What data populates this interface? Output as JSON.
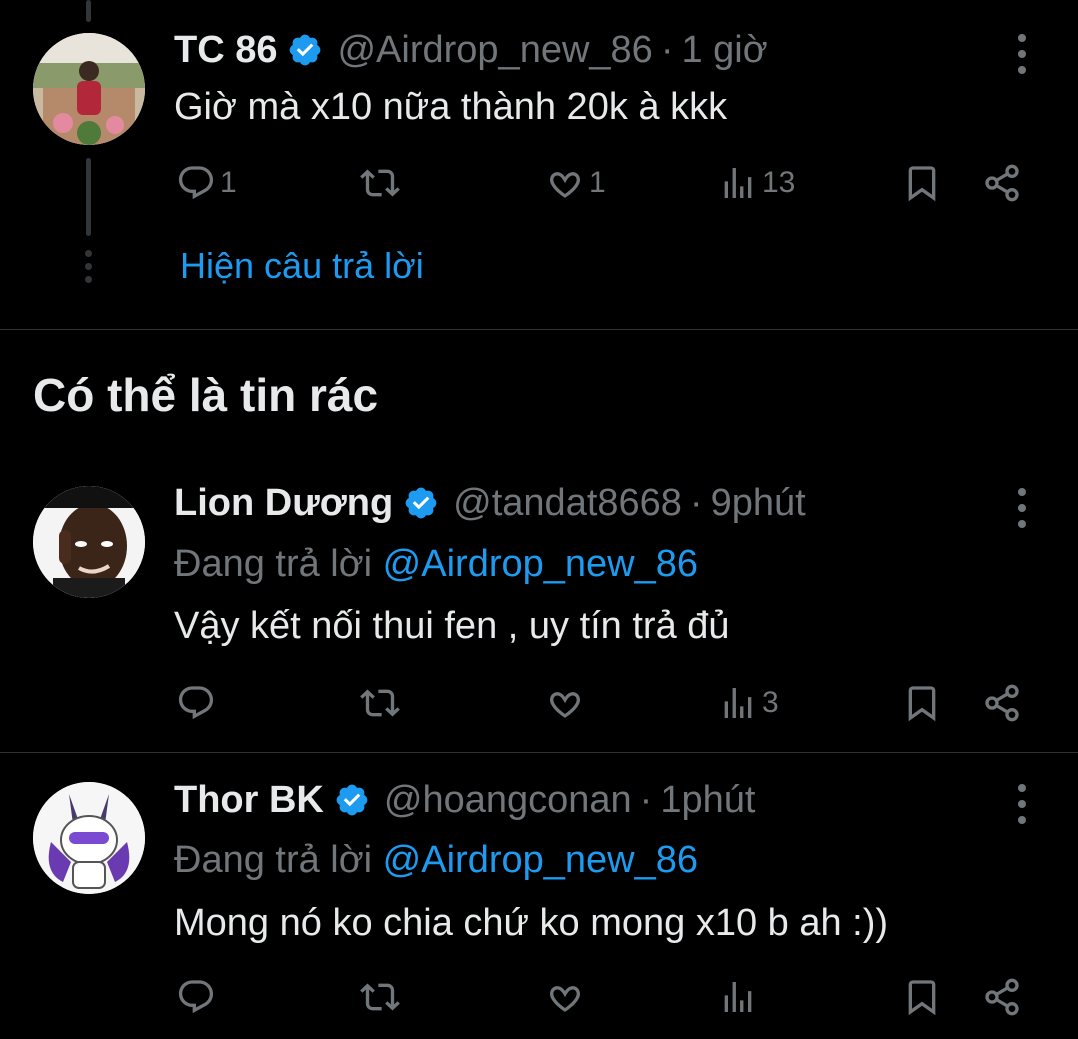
{
  "tweet1": {
    "name": "TC 86",
    "handle": "@Airdrop_new_86",
    "separator": "·",
    "time": "1 giờ",
    "text": "Giờ mà x10 nữa thành 20k à kkk",
    "replies": "1",
    "retweets": "",
    "likes": "1",
    "views": "13",
    "show_replies": "Hiện câu trả lời"
  },
  "section": {
    "title": "Có thể là tin rác"
  },
  "tweet2": {
    "name": "Lion Dương",
    "handle": "@tandat8668",
    "separator": "·",
    "time": "9phút",
    "replying_prefix": "Đang trả lời",
    "replying_to": "@Airdrop_new_86",
    "text": "Vậy kết nối thui fen , uy tín trả đủ",
    "views": "3"
  },
  "tweet3": {
    "name": "Thor BK",
    "handle": "@hoangconan",
    "separator": "·",
    "time": "1phút",
    "replying_prefix": "Đang trả lời",
    "replying_to": "@Airdrop_new_86",
    "text": "Mong nó ko chia chứ ko mong x10 b ah :))"
  },
  "colors": {
    "accent": "#1d9bf0",
    "muted": "#71767b",
    "text": "#e7e9ea",
    "background": "#000000"
  }
}
